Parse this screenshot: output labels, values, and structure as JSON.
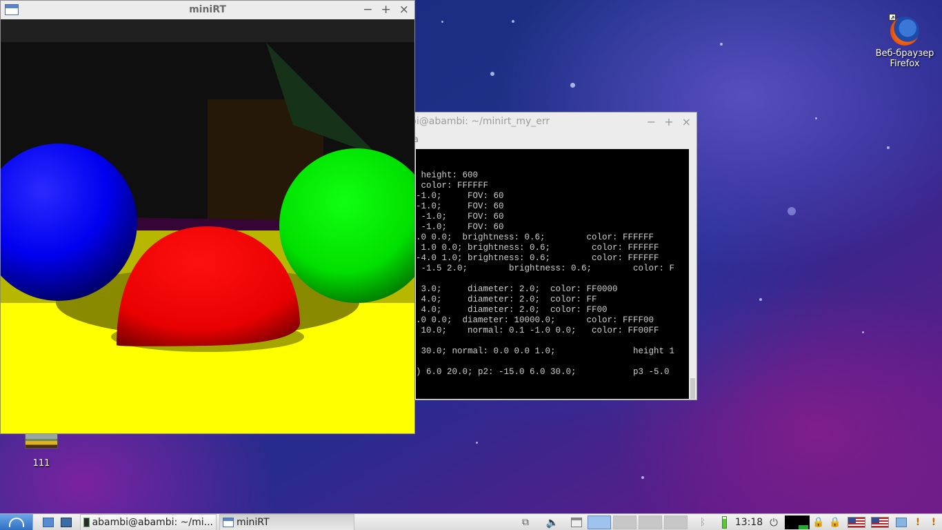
{
  "desktop": {
    "icons": [
      {
        "label_line1": "Веб-браузер",
        "label_line2": "Firefox",
        "icon": "firefox-icon"
      },
      {
        "label": "111",
        "icon": "image-file-icon"
      }
    ]
  },
  "minirt_window": {
    "title": "miniRT",
    "controls": {
      "minimize": "−",
      "maximize": "+",
      "close": "×"
    },
    "scene_colors": {
      "background": "#000000",
      "sphere_blue": "#0000FF",
      "sphere_red": "#FF0000",
      "sphere_green": "#00FF00",
      "plane_yellow": "#FFFF00"
    }
  },
  "terminal_window": {
    "title": "bi@abambi: ~/minirt_my_err",
    "menu_fragment": "a",
    "controls": {
      "minimize": "−",
      "maximize": "+",
      "close": "×"
    },
    "lines": [
      " height: 600",
      " color: FFFFFF",
      "-1.0;     FOV: 60",
      "-1.0;     FOV: 60",
      " -1.0;    FOV: 60",
      " -1.0;    FOV: 60",
      ".0 0.0;  brightness: 0.6;        color: FFFFFF",
      " 1.0 0.0; brightness: 0.6;        color: FFFFFF",
      "-4.0 1.0; brightness: 0.6;        color: FFFFFF",
      " -1.5 2.0;        brightness: 0.6;        color: F",
      "",
      " 3.0;     diameter: 2.0;  color: FF0000",
      " 4.0;     diameter: 2.0;  color: FF",
      " 4.0;     diameter: 2.0;  color: FF00",
      ".0 0.0;  diameter: 10000.0;      color: FFFF00",
      " 10.0;    normal: 0.1 -1.0 0.0;   color: FF00FF",
      "",
      " 30.0; normal: 0.0 0.0 1.0;               height 1",
      "",
      ") 6.0 20.0; p2: -15.0 6.0 30.0;           p3 -5.0"
    ]
  },
  "taskbar": {
    "tasks": [
      {
        "label": "abambi@abambi: ~/mi...",
        "icon": "terminal-icon"
      },
      {
        "label": "miniRT",
        "icon": "window-icon"
      }
    ],
    "clock": "13:18"
  }
}
